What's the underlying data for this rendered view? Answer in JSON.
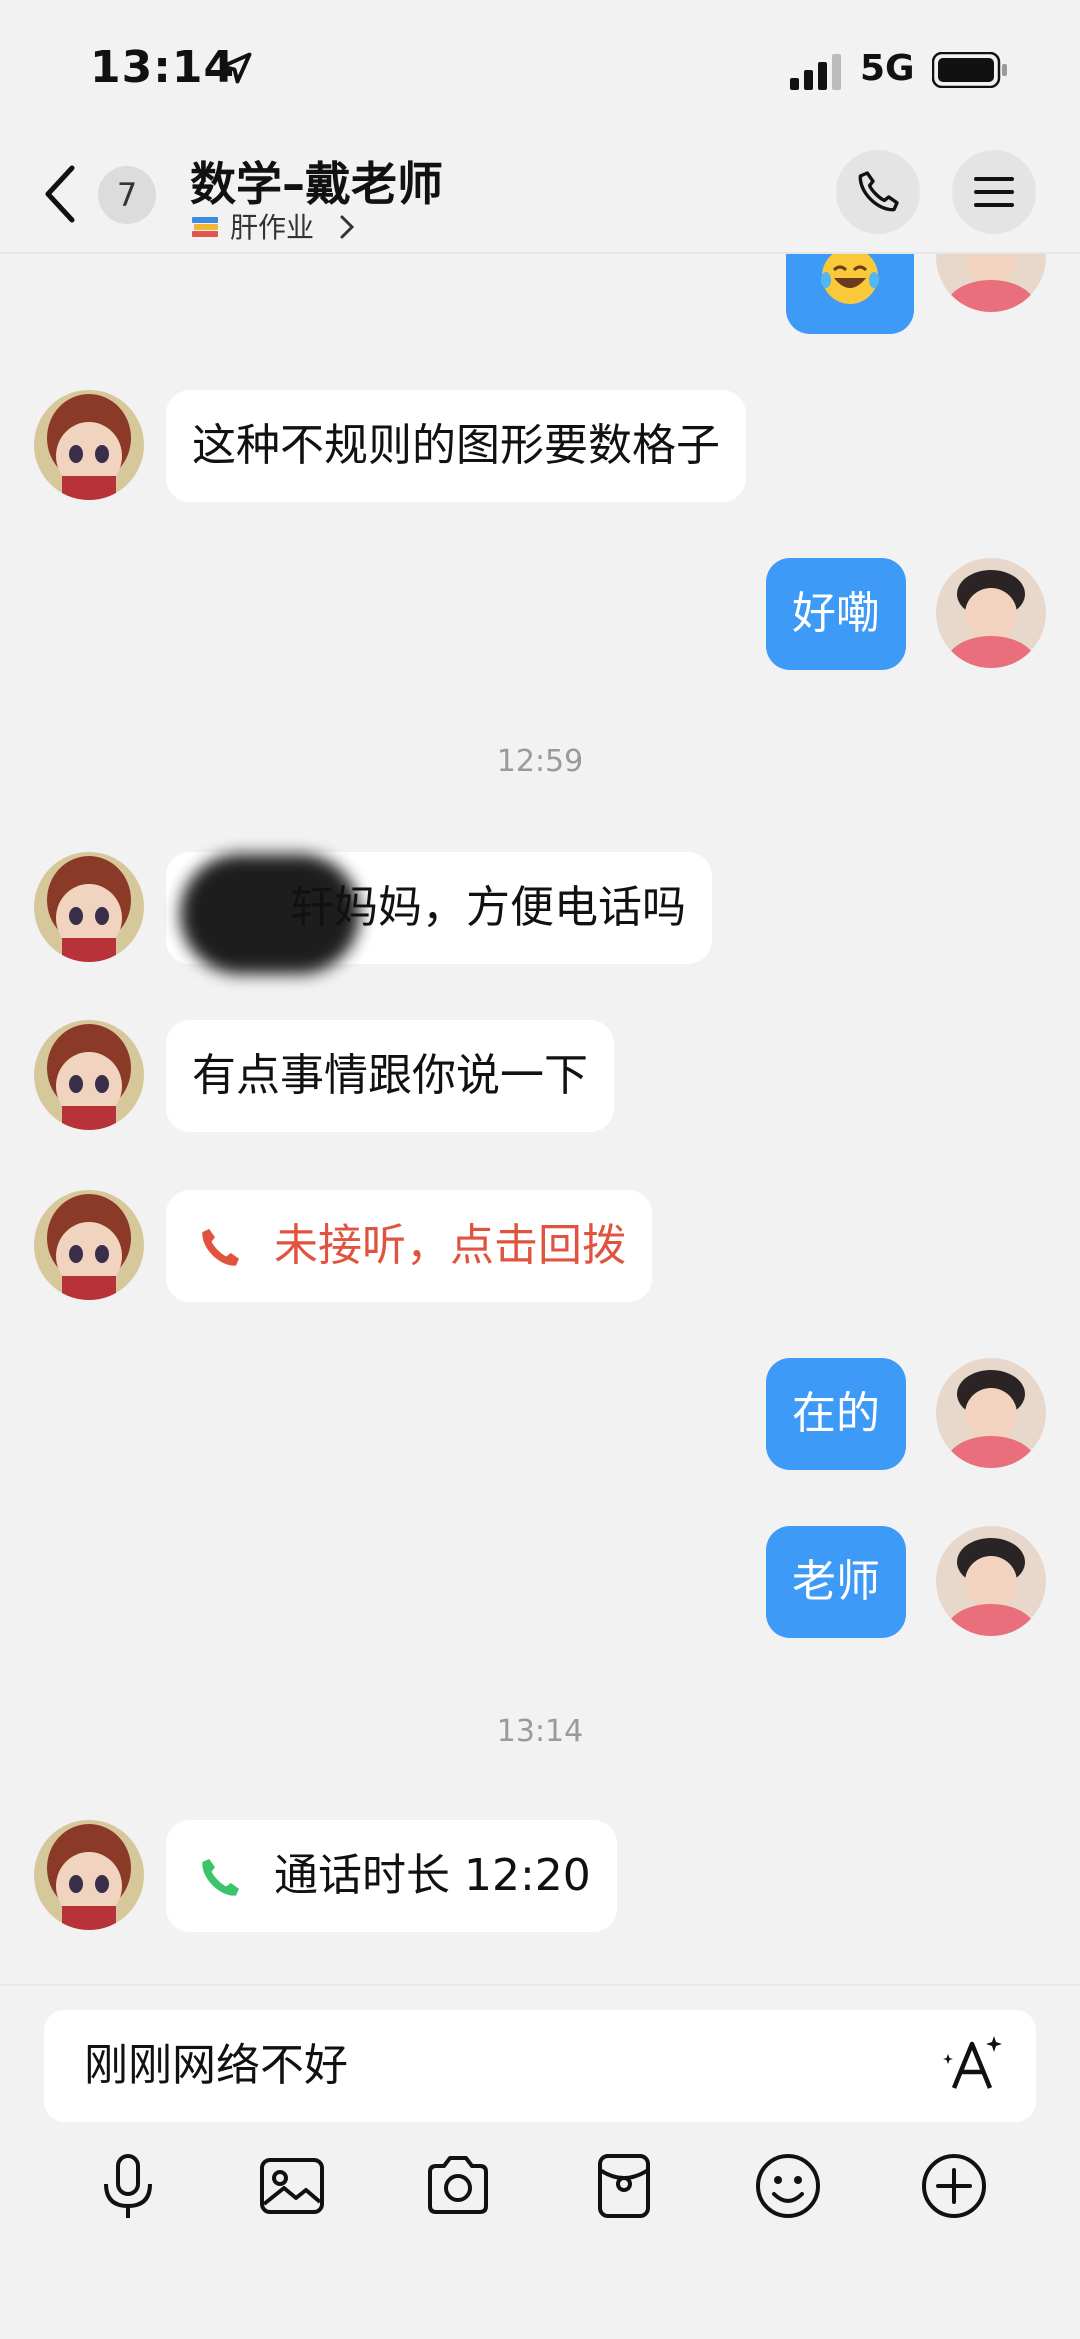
{
  "status_bar": {
    "time": "13:14",
    "network": "5G"
  },
  "header": {
    "unread_count": "7",
    "title": "数学–戴老师",
    "subtitle": "肝作业"
  },
  "messages": [
    {
      "side": "in",
      "text": "这种不规则的图形要数格子"
    },
    {
      "side": "out",
      "text": "好嘞"
    },
    {
      "type": "time",
      "text": "12:59"
    },
    {
      "side": "in",
      "text": "轩妈妈，方便电话吗"
    },
    {
      "side": "in",
      "text": "有点事情跟你说一下"
    },
    {
      "side": "in",
      "type": "call",
      "status": "missed",
      "text": "未接听，点击回拨"
    },
    {
      "side": "out",
      "text": "在的"
    },
    {
      "side": "out",
      "text": "老师"
    },
    {
      "type": "time",
      "text": "13:14"
    },
    {
      "side": "in",
      "type": "call",
      "status": "completed",
      "text": "通话时长 12:20"
    }
  ],
  "input": {
    "value": "刚刚网络不好"
  },
  "toolbar": {
    "icons": [
      "mic-icon",
      "image-icon",
      "camera-icon",
      "red-packet-icon",
      "emoji-icon",
      "plus-icon"
    ]
  },
  "colors": {
    "outgoing_bubble": "#3d9af6",
    "incoming_bubble": "#ffffff",
    "missed_call": "#e0543f",
    "call_green": "#3cc46b",
    "background": "#f2f2f2"
  }
}
